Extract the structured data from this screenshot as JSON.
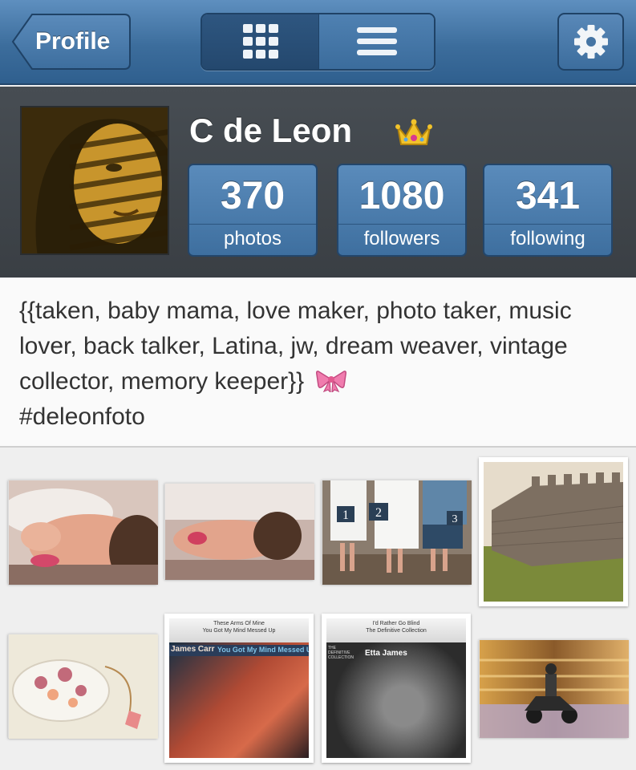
{
  "nav": {
    "back_label": "Profile",
    "grid_view": "grid-icon",
    "list_view": "list-icon",
    "settings": "gear-icon"
  },
  "profile": {
    "name": "C de Leon",
    "badge": "crown-emoji",
    "stats": [
      {
        "value": "370",
        "label": "photos"
      },
      {
        "value": "1080",
        "label": "followers"
      },
      {
        "value": "341",
        "label": "following"
      }
    ]
  },
  "bio": {
    "text": "{{taken, baby mama, love maker, photo taker, music lover, back talker, Latina, jw, dream weaver, vintage collector, memory keeper}}",
    "emoji": "ribbon-emoji",
    "hashtag": "#deleonfoto"
  },
  "photos": {
    "album1": {
      "track": "These Arms Of Mine",
      "line2": "You Got My Mind Messed Up",
      "artist": "James Carr",
      "title": "You Got My Mind Messed Up"
    },
    "album2": {
      "track": "I'd Rather Go Blind",
      "line2": "The Definitive Collection",
      "brand": "THE DEFINITIVE COLLECTION",
      "artist": "Etta James"
    }
  },
  "colors": {
    "nav_blue": "#3c6d9c",
    "header_dark": "#3a3f44",
    "stat_blue": "#4a7cad"
  }
}
